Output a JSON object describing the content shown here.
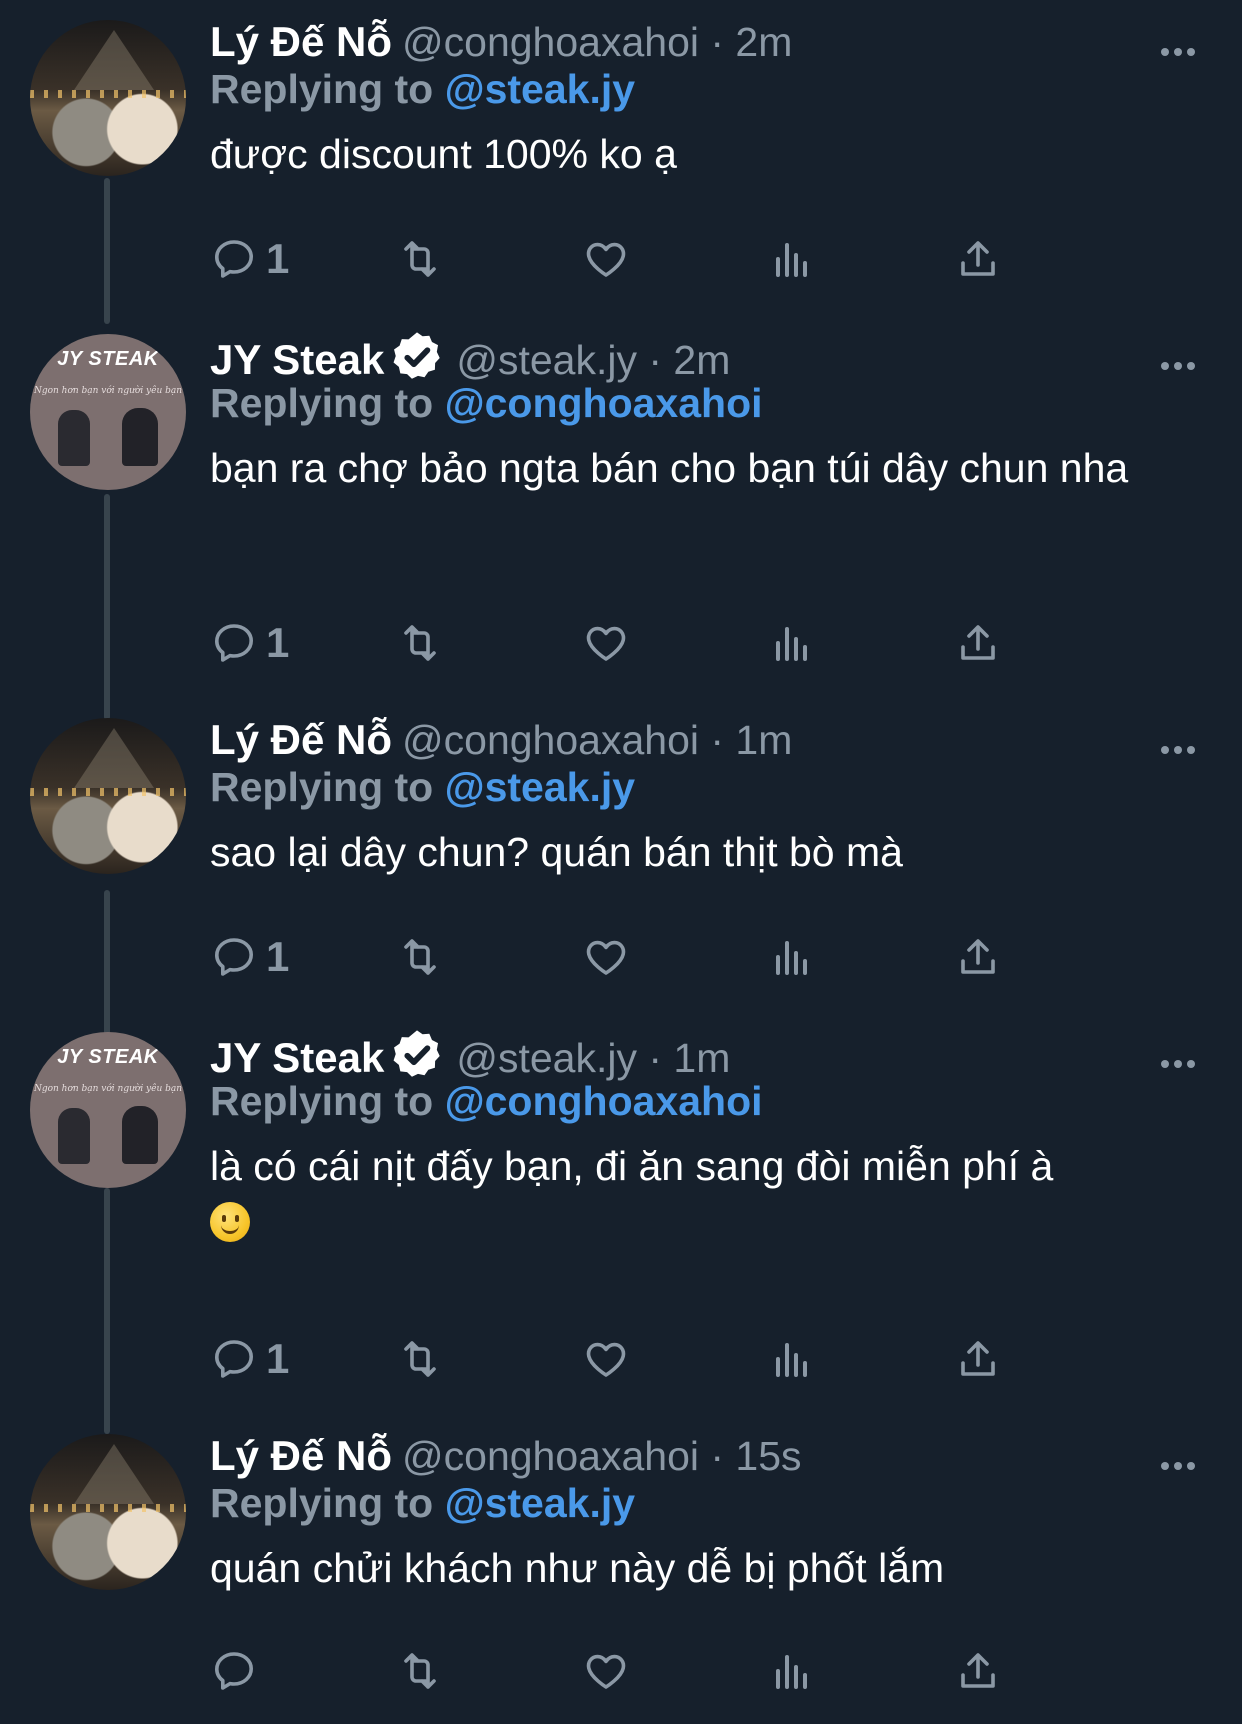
{
  "users": {
    "lydeno": {
      "name": "Lý Đế Nỗ",
      "handle": "@conghoaxahoi"
    },
    "jysteak": {
      "name": "JY Steak",
      "handle": "@steak.jy",
      "avatar_brand": "JY STEAK",
      "avatar_tagline": "Ngon hơn bạn với người yêu bạn"
    }
  },
  "colors": {
    "background": "#16202c",
    "text": "#ffffff",
    "muted": "#8b98a5",
    "mention": "#4a99e9",
    "line": "#38444d"
  },
  "replying_prefix": "Replying to",
  "tweets": [
    {
      "name": "Lý Đế Nỗ",
      "handle_time": "@conghoaxahoi · 2m",
      "reply_to": "@steak.jy",
      "text": "được discount 100% ko ạ",
      "reply_count": "1"
    },
    {
      "name": "JY Steak",
      "handle_time": "@steak.jy · 2m",
      "reply_to": "@conghoaxahoi",
      "text": "bạn ra chợ bảo ngta bán cho bạn túi dây chun nha",
      "reply_count": "1"
    },
    {
      "name": "Lý Đế Nỗ",
      "handle_time": "@conghoaxahoi · 1m",
      "reply_to": "@steak.jy",
      "text": "sao lại dây chun? quán bán thịt bò mà",
      "reply_count": "1"
    },
    {
      "name": "JY Steak",
      "handle_time": "@steak.jy · 1m",
      "reply_to": "@conghoaxahoi",
      "text": "là có cái nịt đấy bạn, đi ăn sang đòi miễn phí à",
      "reply_count": "1"
    },
    {
      "name": "Lý Đế Nỗ",
      "handle_time": "@conghoaxahoi · 15s",
      "reply_to": "@steak.jy",
      "text": "quán chửi khách như này dễ bị phốt lắm",
      "reply_count": ""
    }
  ],
  "icons": [
    "reply-icon",
    "retweet-icon",
    "like-icon",
    "analytics-icon",
    "share-icon",
    "more-icon",
    "verified-badge-icon"
  ]
}
